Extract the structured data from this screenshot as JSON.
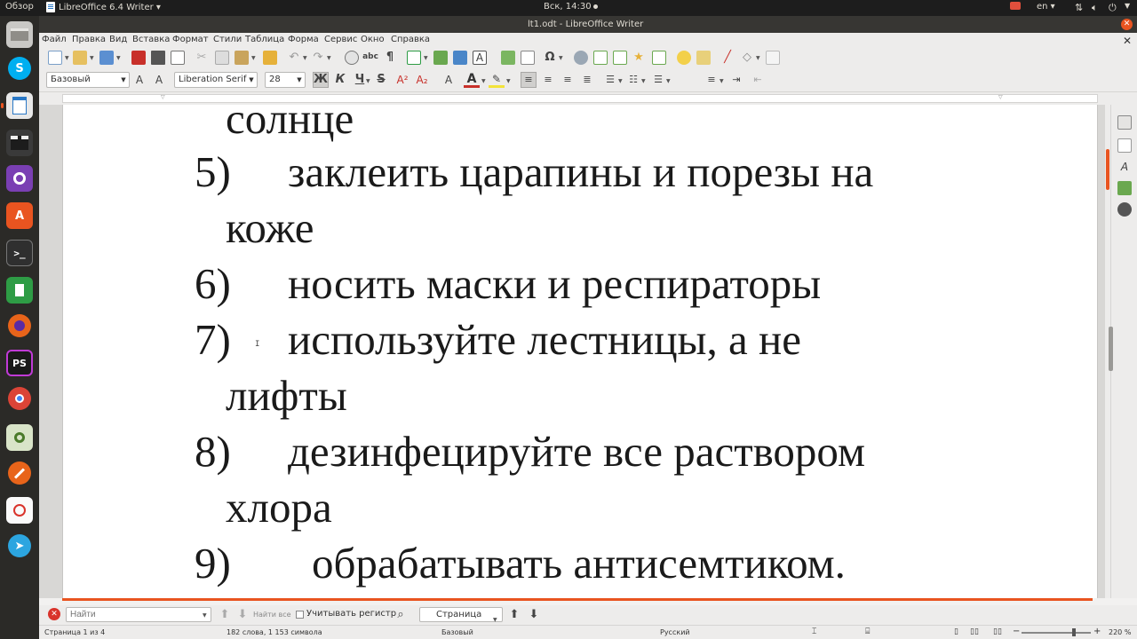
{
  "system": {
    "activities": "Обзор",
    "app_menu": "LibreOffice 6.4 Writer ▾",
    "clock": "Вск, 14:30",
    "lang": "en ▾"
  },
  "window": {
    "title": "lt1.odt - LibreOffice Writer"
  },
  "menu": [
    "Файл",
    "Правка",
    "Вид",
    "Вставка",
    "Формат",
    "Стили",
    "Таблица",
    "Форма",
    "Сервис",
    "Окно",
    "Справка"
  ],
  "formatting": {
    "paragraph_style": "Базовый",
    "font_name": "Liberation Serif",
    "font_size": "28",
    "bold": "Ж",
    "italic": "К",
    "underline": "Ч",
    "strike": "S"
  },
  "document": {
    "lines": [
      {
        "num": "",
        "text": "солнце"
      },
      {
        "num": "5)",
        "text": "заклеить царапины и порезы на"
      },
      {
        "num": "",
        "text": "коже"
      },
      {
        "num": "6)",
        "text": "носить маски  и респираторы"
      },
      {
        "num": "7)",
        "text": "используйте лестницы, а не"
      },
      {
        "num": "",
        "text": "лифты"
      },
      {
        "num": "8)",
        "text": "дезинфецируйте все раствором"
      },
      {
        "num": "",
        "text": "хлора"
      },
      {
        "num": "9)",
        "text": "обрабатывать антисемтиком."
      }
    ]
  },
  "findbar": {
    "placeholder": "Найти",
    "find_all": "Найти все",
    "match_case": "Учитывать регистр",
    "navigate_by": "Страница"
  },
  "status": {
    "page": "Страница 1 из 4",
    "words": "182 слова, 1 153 символа",
    "style": "Базовый",
    "language": "Русский",
    "zoom": "220 %"
  },
  "colors": {
    "accent": "#e95420",
    "dock_bg": "#2b2a27",
    "topbar_bg": "#1d1d1d"
  }
}
